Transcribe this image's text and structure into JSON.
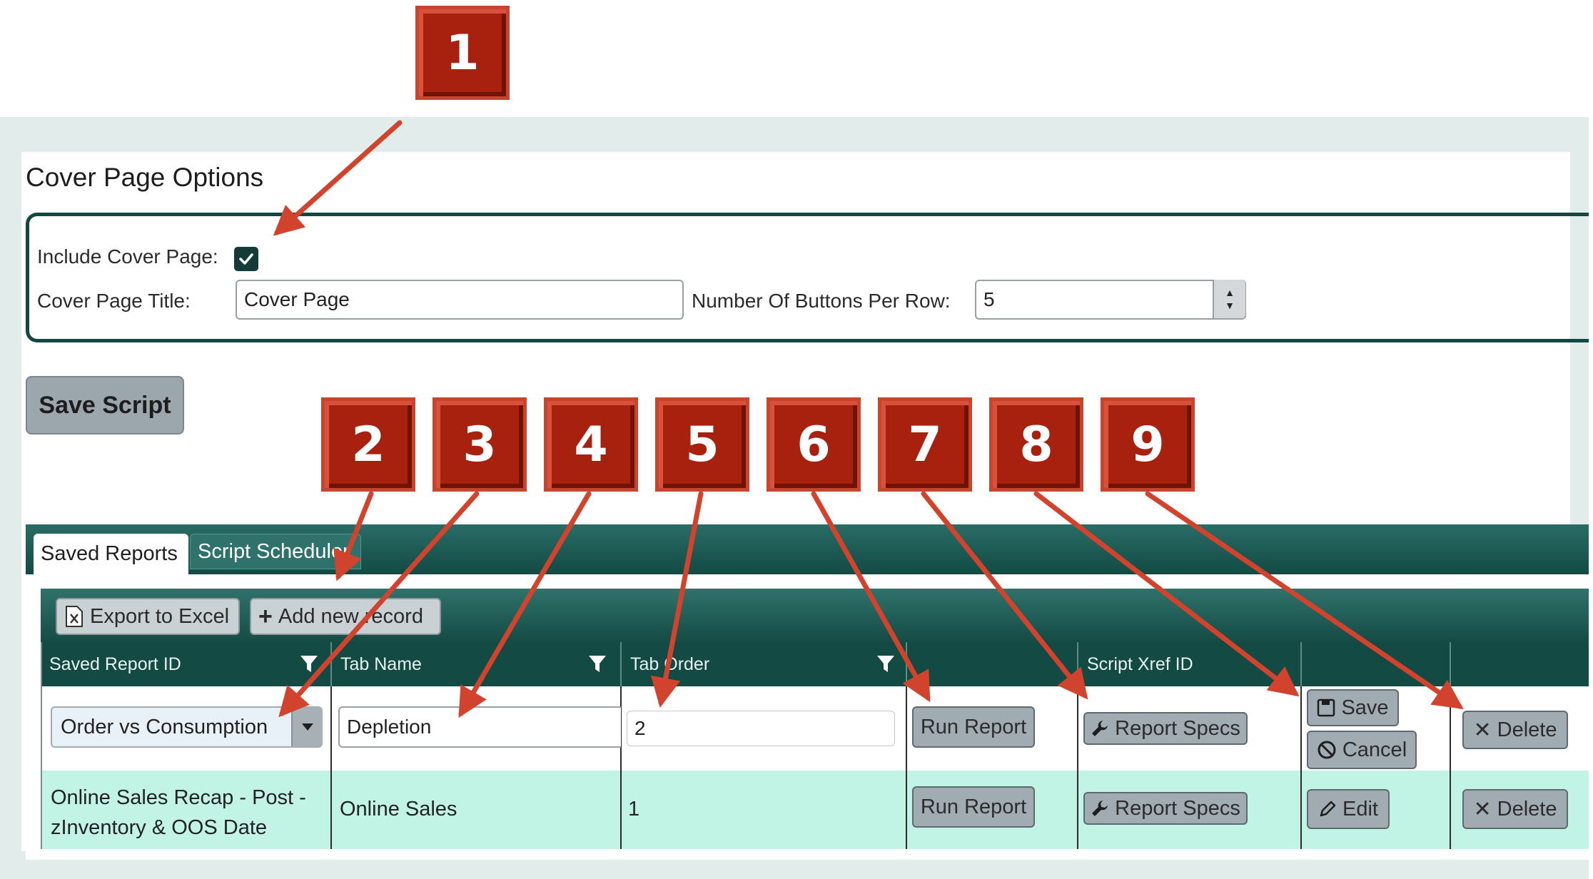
{
  "cover_options": {
    "section_title": "Cover Page Options",
    "include_label": "Include Cover Page:",
    "include_checked": true,
    "title_label": "Cover Page Title:",
    "title_value": "Cover Page",
    "buttons_label": "Number Of Buttons Per Row:",
    "buttons_value": "5"
  },
  "save_script_label": "Save Script",
  "tabs": [
    {
      "label": "Saved Reports",
      "active": true
    },
    {
      "label": "Script Scheduler",
      "active": false
    }
  ],
  "toolbar": {
    "export_label": "Export to Excel",
    "add_label": "Add new record"
  },
  "columns": [
    "Saved Report ID",
    "Tab Name",
    "Tab Order",
    "",
    "Script Xref ID",
    "",
    ""
  ],
  "rows": [
    {
      "saved_report": "Order vs Consumption",
      "tab_name": "Depletion",
      "tab_order": "2",
      "run": "Run Report",
      "specs": "Report Specs",
      "save": "Save",
      "cancel": "Cancel",
      "delete": "Delete"
    },
    {
      "saved_report_line1": "Online Sales Recap - Post -",
      "saved_report_line2": "zInventory & OOS Date",
      "tab_name": "Online Sales",
      "tab_order": "1",
      "run": "Run Report",
      "specs": "Report Specs",
      "edit": "Edit",
      "delete": "Delete"
    }
  ],
  "callouts": [
    "1",
    "2",
    "3",
    "4",
    "5",
    "6",
    "7",
    "8",
    "9"
  ],
  "colors": {
    "accent_dark_teal": "#134a44",
    "callout_red": "#a8210f",
    "row_highlight": "#c2f4e5",
    "button_gray": "#a1abb2"
  }
}
